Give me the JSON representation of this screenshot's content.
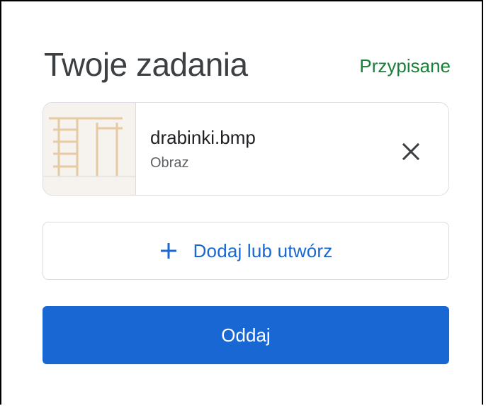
{
  "header": {
    "title": "Twoje zadania",
    "status": "Przypisane"
  },
  "attachment": {
    "file_name": "drabinki.bmp",
    "file_type": "Obraz",
    "thumbnail_icon": "ladder-image-thumbnail",
    "remove_icon": "close-icon"
  },
  "actions": {
    "add_label": "Dodaj lub utwórz",
    "add_icon": "plus-icon",
    "submit_label": "Oddaj"
  },
  "colors": {
    "status_green": "#188038",
    "primary_blue": "#1967d2",
    "border_gray": "#dadce0",
    "text_dark": "#3c4043"
  }
}
